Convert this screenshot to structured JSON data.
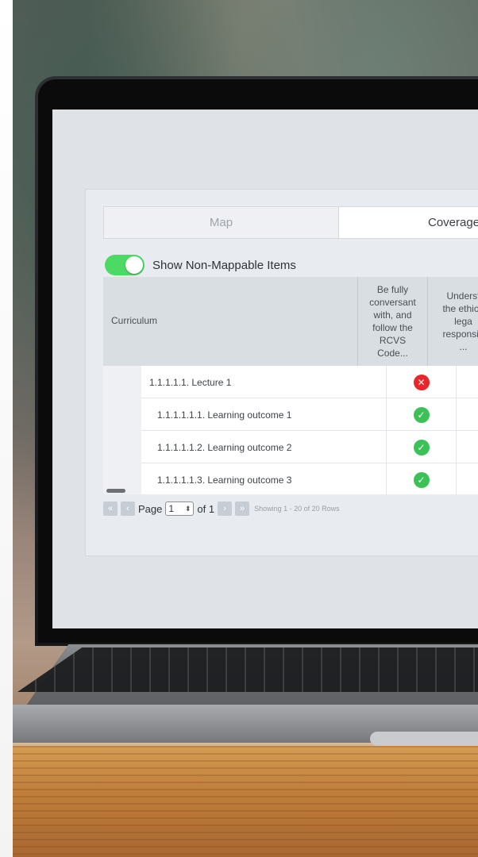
{
  "tabs": [
    {
      "label": "Map",
      "active": false
    },
    {
      "label": "Coverage",
      "active": true
    }
  ],
  "toggle": {
    "label": "Show Non-Mappable Items",
    "on": true,
    "color": "#4cd964"
  },
  "grid": {
    "header": {
      "curriculum": "Curriculum",
      "columns": [
        "Be fully\nconversant\nwith, and\nfollow the\nRCVS\nCode...",
        "Underst\nthe ethica\nlega\nresponsib\n..."
      ]
    },
    "rows": [
      {
        "label": "1.1.1.1.1. Lecture 1",
        "status": "x"
      },
      {
        "label": "1.1.1.1.1.1. Learning outcome 1",
        "status": "check"
      },
      {
        "label": "1.1.1.1.1.2. Learning outcome 2",
        "status": "check"
      },
      {
        "label": "1.1.1.1.1.3. Learning outcome 3",
        "status": "check"
      }
    ]
  },
  "pager": {
    "first_icon": "double-chevron-left-icon",
    "prev_icon": "chevron-left-icon",
    "page_label": "Page",
    "page_value": "1",
    "of_label": "of 1",
    "next_icon": "chevron-right-icon",
    "last_icon": "double-chevron-right-icon",
    "status": "Showing 1 - 20 of 20 Rows"
  },
  "glyphs": {
    "x": "✕",
    "check": "✓",
    "first": "«",
    "prev": "‹",
    "next": "›",
    "last": "»",
    "updown": "⬍"
  },
  "colors": {
    "error": "#e8262b",
    "success": "#3cc157"
  }
}
